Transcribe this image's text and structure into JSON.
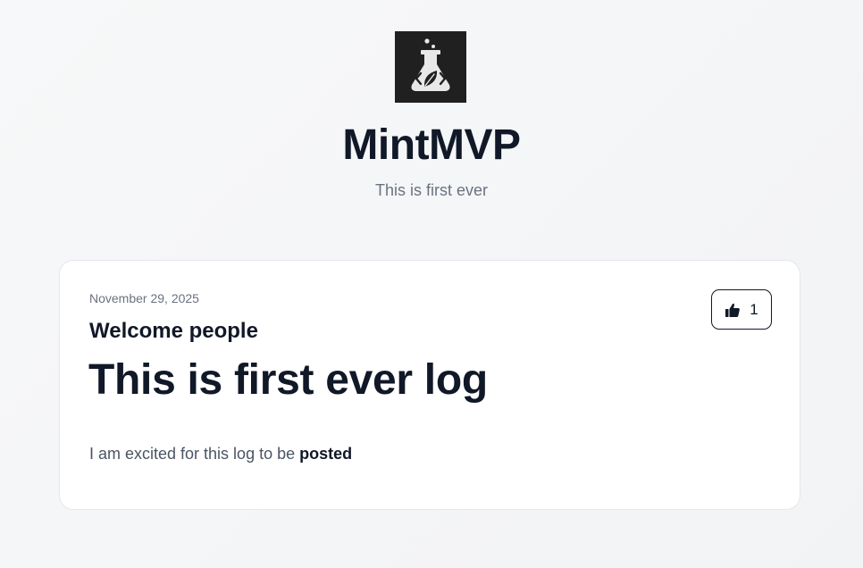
{
  "app": {
    "title": "MintMVP",
    "subtitle": "This is first ever",
    "logo_icon": "flask-leaf-code-icon"
  },
  "post": {
    "date": "November 29, 2025",
    "heading": "Welcome people",
    "title": "This is first ever log",
    "body_text": "I am excited for this log to be ",
    "body_bold": "posted",
    "likes": {
      "icon": "thumbs-up-icon",
      "count": "1"
    }
  },
  "colors": {
    "background": "#f4f5f7",
    "card": "#ffffff",
    "text_primary": "#111827",
    "text_muted": "#6b7280",
    "logo_bg": "#202020"
  }
}
